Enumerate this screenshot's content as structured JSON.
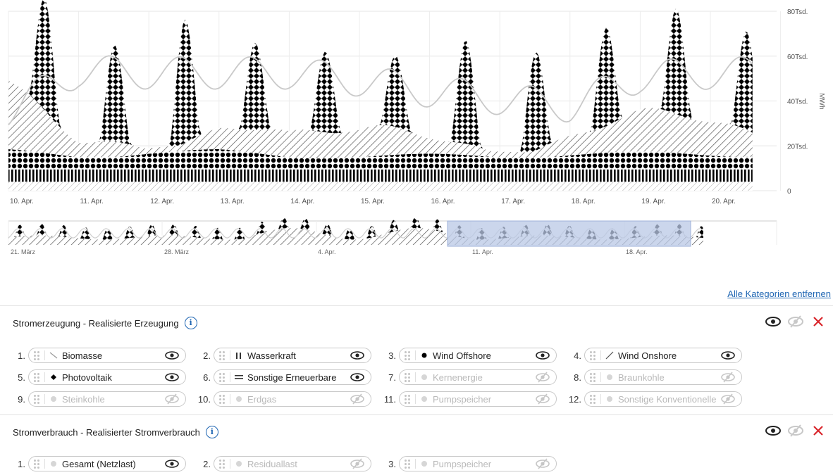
{
  "main_chart": {
    "x_labels": [
      "10. Apr.",
      "11. Apr.",
      "12. Apr.",
      "13. Apr.",
      "14. Apr.",
      "15. Apr.",
      "16. Apr.",
      "17. Apr.",
      "18. Apr.",
      "19. Apr.",
      "20. Apr."
    ],
    "y_ticks": [
      "80Tsd.",
      "60Tsd.",
      "40Tsd.",
      "20Tsd.",
      "0"
    ],
    "y_unit": "MWh"
  },
  "chart_data": {
    "type": "area",
    "x": [
      "10. Apr.",
      "11. Apr.",
      "12. Apr.",
      "13. Apr.",
      "14. Apr.",
      "15. Apr.",
      "16. Apr.",
      "17. Apr.",
      "18. Apr.",
      "19. Apr.",
      "20. Apr."
    ],
    "ylim": [
      0,
      80000
    ],
    "ylabel": "MWh",
    "series": [
      {
        "name": "Photovoltaik",
        "kind": "area",
        "values": [
          50000,
          43000,
          55000,
          39000,
          36000,
          32000,
          46000,
          44000,
          44000,
          47000,
          44000
        ]
      },
      {
        "name": "Wind Onshore",
        "kind": "area",
        "values": [
          31000,
          14000,
          24000,
          27000,
          12000,
          13000,
          18000,
          18000,
          19000,
          19000,
          17000
        ]
      },
      {
        "name": "Wind Offshore",
        "kind": "area",
        "values": [
          9000,
          7000,
          9000,
          9000,
          7000,
          7000,
          7000,
          7000,
          8000,
          8000,
          8000
        ]
      },
      {
        "name": "Wasserkraft",
        "kind": "area",
        "values": [
          5500,
          5500,
          5500,
          5500,
          5500,
          5500,
          5500,
          5500,
          5500,
          5500,
          5500
        ]
      },
      {
        "name": "Biomasse",
        "kind": "area",
        "values": [
          4000,
          4000,
          4000,
          4000,
          4000,
          4000,
          4000,
          4000,
          4000,
          4000,
          4000
        ]
      },
      {
        "name": "Gesamt (Netzlast)",
        "kind": "line",
        "values": [
          44000,
          65000,
          64000,
          64000,
          64000,
          60000,
          54000,
          50000,
          46000,
          62000,
          64000
        ]
      }
    ]
  },
  "navigator": {
    "labels": [
      "21. März",
      "28. März",
      "4. Apr.",
      "11. Apr.",
      "18. Apr."
    ]
  },
  "remove_all_label": "Alle Kategorien entfernen",
  "sections": [
    {
      "title": "Stromerzeugung - Realisierte Erzeugung",
      "items": [
        {
          "num": "1.",
          "label": "Biomasse",
          "symbol": "biomasse-icon",
          "active": true
        },
        {
          "num": "2.",
          "label": "Wasserkraft",
          "symbol": "wasserkraft-icon",
          "active": true
        },
        {
          "num": "3.",
          "label": "Wind Offshore",
          "symbol": "wind-offshore-icon",
          "active": true
        },
        {
          "num": "4.",
          "label": "Wind Onshore",
          "symbol": "wind-onshore-icon",
          "active": true
        },
        {
          "num": "5.",
          "label": "Photovoltaik",
          "symbol": "photovoltaik-icon",
          "active": true
        },
        {
          "num": "6.",
          "label": "Sonstige Erneuerbare",
          "symbol": "sonstige-erneuerbare-icon",
          "active": true
        },
        {
          "num": "7.",
          "label": "Kernenergie",
          "symbol": "dot-icon",
          "active": false
        },
        {
          "num": "8.",
          "label": "Braunkohle",
          "symbol": "dot-icon",
          "active": false
        },
        {
          "num": "9.",
          "label": "Steinkohle",
          "symbol": "dot-icon",
          "active": false
        },
        {
          "num": "10.",
          "label": "Erdgas",
          "symbol": "dot-icon",
          "active": false
        },
        {
          "num": "11.",
          "label": "Pumpspeicher",
          "symbol": "dot-icon",
          "active": false
        },
        {
          "num": "12.",
          "label": "Sonstige Konventionelle",
          "symbol": "dot-icon",
          "active": false
        }
      ]
    },
    {
      "title": "Stromverbrauch - Realisierter Stromverbrauch",
      "items": [
        {
          "num": "1.",
          "label": "Gesamt (Netzlast)",
          "symbol": "dot-icon",
          "active": true
        },
        {
          "num": "2.",
          "label": "Residuallast",
          "symbol": "dot-icon",
          "active": false
        },
        {
          "num": "3.",
          "label": "Pumpspeicher",
          "symbol": "dot-icon",
          "active": false
        }
      ]
    }
  ],
  "colors": {
    "link": "#1f66b3",
    "danger": "#d9262c",
    "inactive_text": "#b9b9b9",
    "navigator_selection": "#b9c8e6"
  }
}
